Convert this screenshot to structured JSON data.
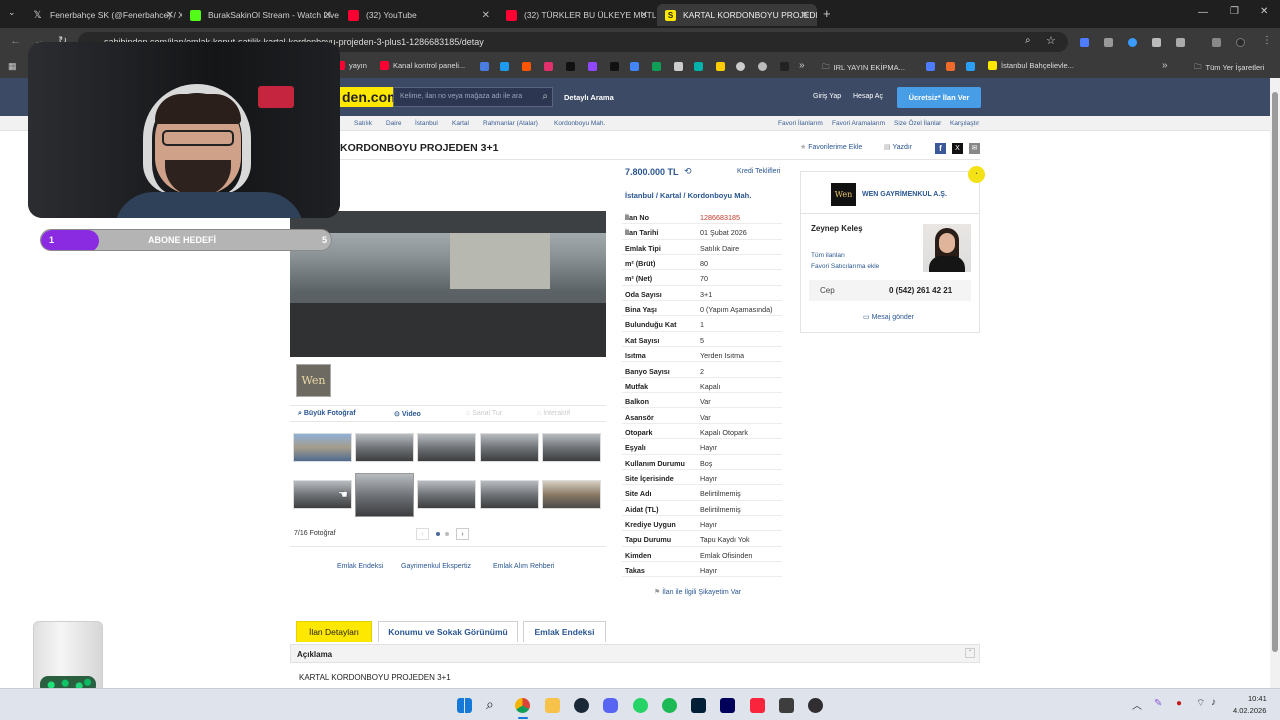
{
  "browser": {
    "tabs": [
      {
        "label": "Fenerbahçe SK (@Fenerbahce) / X",
        "icon": "x-logo-icon",
        "color": "#cccccc"
      },
      {
        "label": "BurakSakinOl Stream - Watch Live",
        "icon": "kick-logo-icon",
        "color": "#53fc18"
      },
      {
        "label": "(32) YouTube",
        "icon": "youtube-icon",
        "color": "#ff0033"
      },
      {
        "label": "(32) TÜRKLER BU ÜLKEYE MUTLAKA",
        "icon": "youtube-icon",
        "color": "#ff0033"
      },
      {
        "label": "KARTAL KORDONBOYU PROJEDEN",
        "icon": "sahibinden-icon",
        "color": "#ffe800"
      }
    ],
    "url": "sahibinden.com/ilan/emlak-konut-satilik-kartal-kordonboyu-projeden-3-plus1-1286683185/detay",
    "bookmarks": [
      {
        "label": "yayın"
      },
      {
        "label": "Kanal kontrol paneli..."
      },
      {
        "label": "IRL YAYIN EKİPMA..."
      },
      {
        "label": "İstanbul Bahçelievle..."
      },
      {
        "label": "Tüm Yer İşaretleri"
      }
    ],
    "overflow": "»"
  },
  "site": {
    "logo": "den.com",
    "search_placeholder": "Kelime, ilan no veya mağaza adı ile ara",
    "detailed_search": "Detaylı Arama",
    "login": "Giriş Yap",
    "signup": "Hesap Aç",
    "post_ad": "Ücretsiz* İlan Ver"
  },
  "breadcrumb": {
    "items": [
      "Satılık",
      "Daire",
      "İstanbul",
      "Kartal",
      "Rahmanlar (Atalar)",
      "Kordonboyu Mah."
    ],
    "right": [
      "Favori İlanlarım",
      "Favori Aramalarım",
      "Size Özel İlanlar",
      "Karşılaştır"
    ]
  },
  "listing": {
    "title": "KORDONBOYU PROJEDEN 3+1",
    "fav": "Favorilerime Ekle",
    "print": "Yazdır",
    "price": "7.800.000 TL",
    "credit": "Kredi Teklifleri",
    "location": [
      "İstanbul",
      "Kartal",
      "Kordonboyu Mah."
    ],
    "photo_tools": [
      "Büyük Fotoğraf",
      "Video",
      "Sanal Tur",
      "İnteraktif"
    ],
    "photo_counter": "7/16 Fotoğraf",
    "agency_badge": "Wen",
    "links": [
      "Emlak Endeksi",
      "Gayrimenkul Ekspertiz",
      "Emlak Alım Rehberi"
    ],
    "complaint": "İlan ile İlgili Şikayetim Var",
    "specs": [
      {
        "label": "İlan No",
        "value": "1286683185"
      },
      {
        "label": "İlan Tarihi",
        "value": "01 Şubat 2026"
      },
      {
        "label": "Emlak Tipi",
        "value": "Satılık Daire"
      },
      {
        "label": "m² (Brüt)",
        "value": "80"
      },
      {
        "label": "m² (Net)",
        "value": "70"
      },
      {
        "label": "Oda Sayısı",
        "value": "3+1"
      },
      {
        "label": "Bina Yaşı",
        "value": "0 (Yapım Aşamasında)"
      },
      {
        "label": "Bulunduğu Kat",
        "value": "1"
      },
      {
        "label": "Kat Sayısı",
        "value": "5"
      },
      {
        "label": "Isıtma",
        "value": "Yerden Isıtma"
      },
      {
        "label": "Banyo Sayısı",
        "value": "2"
      },
      {
        "label": "Mutfak",
        "value": "Kapalı"
      },
      {
        "label": "Balkon",
        "value": "Var"
      },
      {
        "label": "Asansör",
        "value": "Var"
      },
      {
        "label": "Otopark",
        "value": "Kapalı Otopark"
      },
      {
        "label": "Eşyalı",
        "value": "Hayır"
      },
      {
        "label": "Kullanım Durumu",
        "value": "Boş"
      },
      {
        "label": "Site İçerisinde",
        "value": "Hayır"
      },
      {
        "label": "Site Adı",
        "value": "Belirtilmemiş"
      },
      {
        "label": "Aidat (TL)",
        "value": "Belirtilmemiş"
      },
      {
        "label": "Krediye Uygun",
        "value": "Hayır"
      },
      {
        "label": "Tapu Durumu",
        "value": "Tapu Kaydı Yok"
      },
      {
        "label": "Kimden",
        "value": "Emlak Ofisinden"
      },
      {
        "label": "Takas",
        "value": "Hayır"
      }
    ]
  },
  "seller": {
    "company": "WEN GAYRİMENKUL A.Ş.",
    "logo": "Wen",
    "name": "Zeynep Keleş",
    "all_ads": "Tüm ilanları",
    "fav_seller": "Favori Satıcılarıma ekle",
    "phone_label": "Cep",
    "phone": "0 (542) 261 42 21",
    "message": "Mesaj gönder"
  },
  "bottom_tabs": [
    "İlan Detayları",
    "Konumu ve Sokak Görünümü",
    "Emlak Endeksi"
  ],
  "description": {
    "header": "Açıklama",
    "text": "KARTAL KORDONBOYU PROJEDEN 3+1"
  },
  "overlay": {
    "goal_label": "ABONE HEDEFİ",
    "goal_current": "1",
    "goal_target": "5",
    "goal_progress": 0.2
  },
  "taskbar": {
    "time": "10:41",
    "date": "4.02.2026"
  }
}
